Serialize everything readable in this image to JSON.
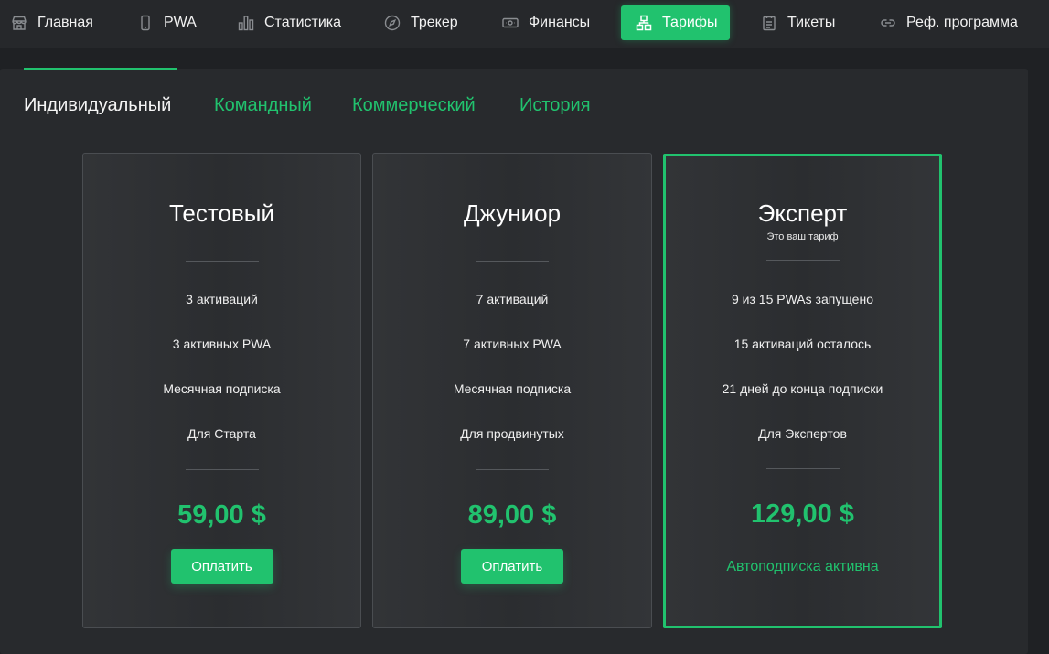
{
  "nav": {
    "items": [
      {
        "label": "Главная",
        "icon": "store-icon"
      },
      {
        "label": "PWA",
        "icon": "phone-icon"
      },
      {
        "label": "Статистика",
        "icon": "bar-chart-icon"
      },
      {
        "label": "Трекер",
        "icon": "compass-icon"
      },
      {
        "label": "Финансы",
        "icon": "banknote-icon"
      },
      {
        "label": "Тарифы",
        "icon": "sitemap-icon",
        "active": true
      },
      {
        "label": "Тикеты",
        "icon": "clipboard-icon"
      },
      {
        "label": "Реф. программа",
        "icon": "link-icon"
      }
    ]
  },
  "tabs": [
    {
      "label": "Индивидуальный",
      "active": true
    },
    {
      "label": "Командный"
    },
    {
      "label": "Коммерческий"
    },
    {
      "label": "История"
    }
  ],
  "plans": [
    {
      "title": "Тестовый",
      "features": [
        "3 активаций",
        "3 активных PWA",
        "Месячная подписка",
        "Для Старта"
      ],
      "price": "59,00 $",
      "button": "Оплатить"
    },
    {
      "title": "Джуниор",
      "features": [
        "7 активаций",
        "7 активных PWA",
        "Месячная подписка",
        "Для продвинутых"
      ],
      "price": "89,00 $",
      "button": "Оплатить"
    },
    {
      "title": "Эксперт",
      "subtitle": "Это ваш тариф",
      "features": [
        "9 из 15 PWAs запущено",
        "15 активаций осталось",
        "21 дней до конца подписки",
        "Для Экспертов"
      ],
      "price": "129,00 $",
      "status": "Автоподписка активна",
      "current": true
    }
  ],
  "colors": {
    "accent": "#21c26e",
    "background": "#1f2124",
    "panel": "#282a2d"
  }
}
